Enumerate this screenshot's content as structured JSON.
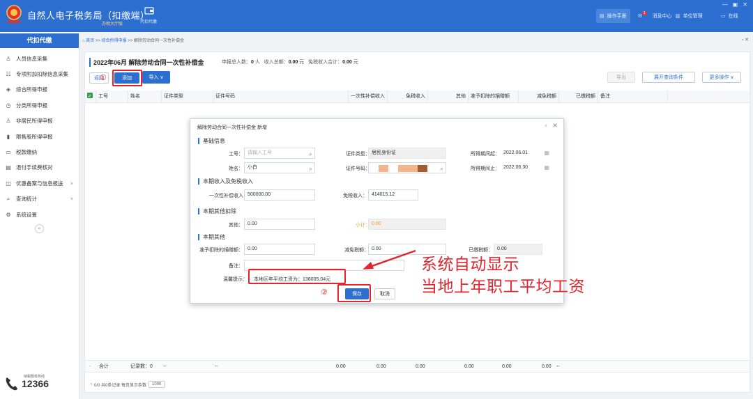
{
  "app": {
    "title": "自然人电子税务局（扣缴端）",
    "subtitle": "办税大厅版",
    "toolbar_item": "代扣代缴",
    "right_items": [
      {
        "label": "操作手册",
        "icon": "manual-icon"
      },
      {
        "label": "消息中心",
        "icon": "mail-icon",
        "badge": "1"
      },
      {
        "label": "单位管理",
        "icon": "building-icon"
      },
      {
        "label": "在线",
        "icon": "online-icon"
      }
    ],
    "window_controls": [
      "—",
      "▣",
      "✕"
    ]
  },
  "sidebar": {
    "header": "代扣代缴",
    "items": [
      {
        "label": "人员信息采集",
        "icon": "person-icon"
      },
      {
        "label": "专项附加扣除信息采集",
        "icon": "list-icon"
      },
      {
        "label": "综合所得申报",
        "icon": "layers-icon"
      },
      {
        "label": "分类所得申报",
        "icon": "clock-icon"
      },
      {
        "label": "非居民所得申报",
        "icon": "user-icon"
      },
      {
        "label": "限售股所得申报",
        "icon": "bar-chart-icon"
      },
      {
        "label": "税款缴纳",
        "icon": "folder-icon"
      },
      {
        "label": "退付手续费核对",
        "icon": "doc-icon"
      },
      {
        "label": "优惠备案与信息报送",
        "icon": "gift-icon",
        "has_chevron": true
      },
      {
        "label": "查询统计",
        "icon": "search-doc-icon",
        "has_chevron": true
      },
      {
        "label": "系统设置",
        "icon": "gear-icon"
      }
    ],
    "hotline_caption": "纳税服务热线",
    "hotline_number": "12366"
  },
  "breadcrumb": {
    "home": "首页",
    "sep": ">>",
    "level1": "综合所得申报",
    "level2": "解除劳动合同一次性补偿金"
  },
  "page": {
    "title": "2022年06月 解除劳动合同一次性补偿金",
    "summary_labels": [
      "申报总人数：",
      "收入总额：",
      "免税收入合计："
    ],
    "summary_values": [
      "0",
      "0.00",
      "0.00"
    ],
    "summary_units": [
      "人",
      "元",
      "元"
    ]
  },
  "toolbar": {
    "back": "返回",
    "add": "添加",
    "import": "导入",
    "export": "导出",
    "expand_query": "展开查询条件",
    "more": "更多操作"
  },
  "table": {
    "columns": [
      "工号",
      "姓名",
      "证件类型",
      "证件号码",
      "一次性补偿收入",
      "免税收入",
      "其他",
      "准予扣除的捐赠额",
      "减免税额",
      "已缴税额",
      "备注"
    ],
    "footer": {
      "total_label": "合计",
      "count_label": "记录数：0",
      "dash": "--",
      "sums": [
        "0.00",
        "0.00",
        "0.00",
        "0.00",
        "0.00",
        "0.00"
      ]
    }
  },
  "pager": {
    "text": "0/0 共0条记录 每页显示条数",
    "page_size": "1000"
  },
  "dialog": {
    "title": "解除劳动合同一次性补偿金 新增",
    "sections": [
      "基础信息",
      "本期收入及免税收入",
      "本期其他扣除",
      "本期其他"
    ],
    "labels": {
      "emp_no": "工号：",
      "id_type": "证件类型：",
      "period_start": "所得期间起：",
      "name": "姓名：",
      "id_no": "证件号码：",
      "period_end": "所得期间止：",
      "severance": "一次性补偿收入",
      "tax_free": "免税收入：",
      "other": "其他：",
      "subtotal": "小计：",
      "donation": "准予扣除的捐赠额：",
      "reduction": "减免税额：",
      "paid": "已缴税额：",
      "remark": "备注：",
      "tip": "温馨提示："
    },
    "values": {
      "emp_no_placeholder": "请输入工号",
      "id_type": "居民身份证",
      "period_start": "2022.06.01",
      "name": "小白",
      "period_end": "2022.06.30",
      "severance": "500000.00",
      "tax_free": "414015.12",
      "other": "0.00",
      "subtotal": "0.00",
      "donation": "0.00",
      "reduction": "0.00",
      "paid": "0.00",
      "remark": ""
    },
    "tip_text": "本地区年平均工资为：138005.04元",
    "save": "保存",
    "cancel": "取消"
  },
  "annotation": {
    "step1": "①",
    "step2": "②",
    "line1": "系统自动显示",
    "line2": "当地上年职工平均工资"
  },
  "colors": {
    "brand": "#2d6fd0",
    "annotation_red": "#e4242c",
    "subtotal_orange": "#f0a020",
    "check_green": "#2ea24a"
  }
}
